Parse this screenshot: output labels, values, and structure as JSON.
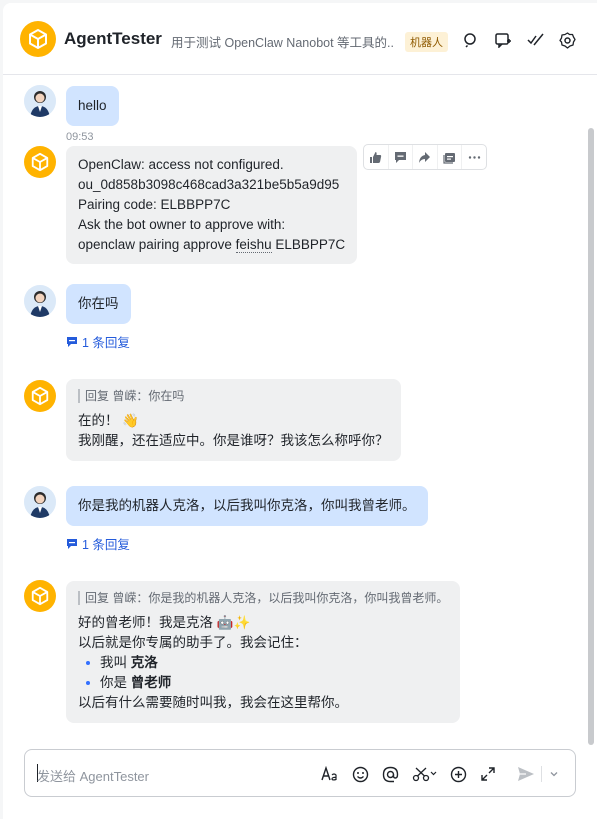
{
  "header": {
    "title": "AgentTester",
    "description": "用于测试 OpenClaw Nanobot 等工具的...",
    "badge": "机器人",
    "icons": [
      "search-icon",
      "add-chat-icon",
      "checklist-icon",
      "settings-icon"
    ]
  },
  "messages": [
    {
      "sender": "user",
      "text": "hello",
      "time": "09:53"
    },
    {
      "sender": "bot",
      "lines": [
        "OpenClaw: access not configured.",
        "ou_0d858b3098c468cad3a321be5b5a9d95",
        "Pairing code: ELBBPP7C",
        "Ask the bot owner to approve with:"
      ],
      "last_line_pre": "openclaw pairing approve ",
      "last_line_underlined": "feishu",
      "last_line_post": " ELBBPP7C"
    },
    {
      "sender": "user",
      "text": "你在吗",
      "reply_count": "1 条回复"
    },
    {
      "sender": "bot",
      "quote": "回复 曾嵘：你在吗",
      "line1": "在的！ 👋",
      "line2": "我刚醒，还在适应中。你是谁呀？我该怎么称呼你？"
    },
    {
      "sender": "user",
      "text": "你是我的机器人克洛，以后我叫你克洛，你叫我曾老师。",
      "reply_count": "1 条回复"
    },
    {
      "sender": "bot",
      "quote": "回复 曾嵘：你是我的机器人克洛，以后我叫你克洛，你叫我曾老师。",
      "line1": "好的曾老师！我是克洛 🤖✨",
      "line2": "以后就是你专属的助手了。我会记住：",
      "bullets": [
        {
          "pre": "我叫 ",
          "bold": "克洛"
        },
        {
          "pre": "你是 ",
          "bold": "曾老师"
        }
      ],
      "line3": "以后有什么需要随时叫我，我会在这里帮你。"
    }
  ],
  "hover_toolbar": [
    "thumbs-up-icon",
    "comment-icon",
    "forward-icon",
    "reply-icon",
    "more-icon"
  ],
  "input": {
    "placeholder": "发送给 AgentTester"
  },
  "colors": {
    "accent": "#3370ff",
    "bot_avatar": "#ffb300",
    "user_bubble": "#d1e4ff",
    "bot_bubble": "#eff0f1"
  }
}
